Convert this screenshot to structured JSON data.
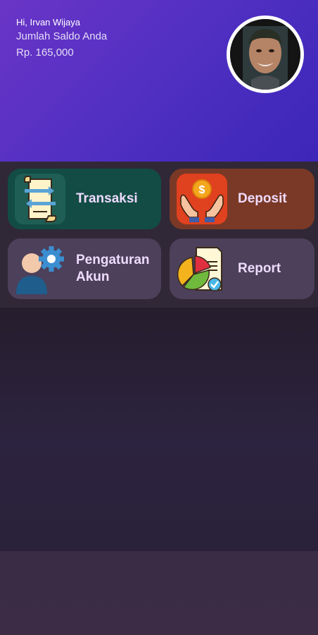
{
  "header": {
    "greeting": "Hi,  Irvan Wijaya",
    "balance_label": "Jumlah Saldo Anda",
    "balance_value": "Rp. 165,000"
  },
  "menu": {
    "items": [
      {
        "label": "Transaksi",
        "icon": "transaction-document-icon",
        "color": "#124c44"
      },
      {
        "label": "Deposit",
        "icon": "money-hands-icon",
        "color": "#7a3926"
      },
      {
        "label": "Pengaturan Akun",
        "icon": "user-gear-icon",
        "color": "#4c405a"
      },
      {
        "label": "Report",
        "icon": "pie-chart-report-icon",
        "color": "#4c405a"
      }
    ]
  },
  "colors": {
    "header_start": "#6a35c7",
    "header_end": "#3c26b8",
    "label_text": "#efdbff",
    "background": "#2a2131"
  }
}
